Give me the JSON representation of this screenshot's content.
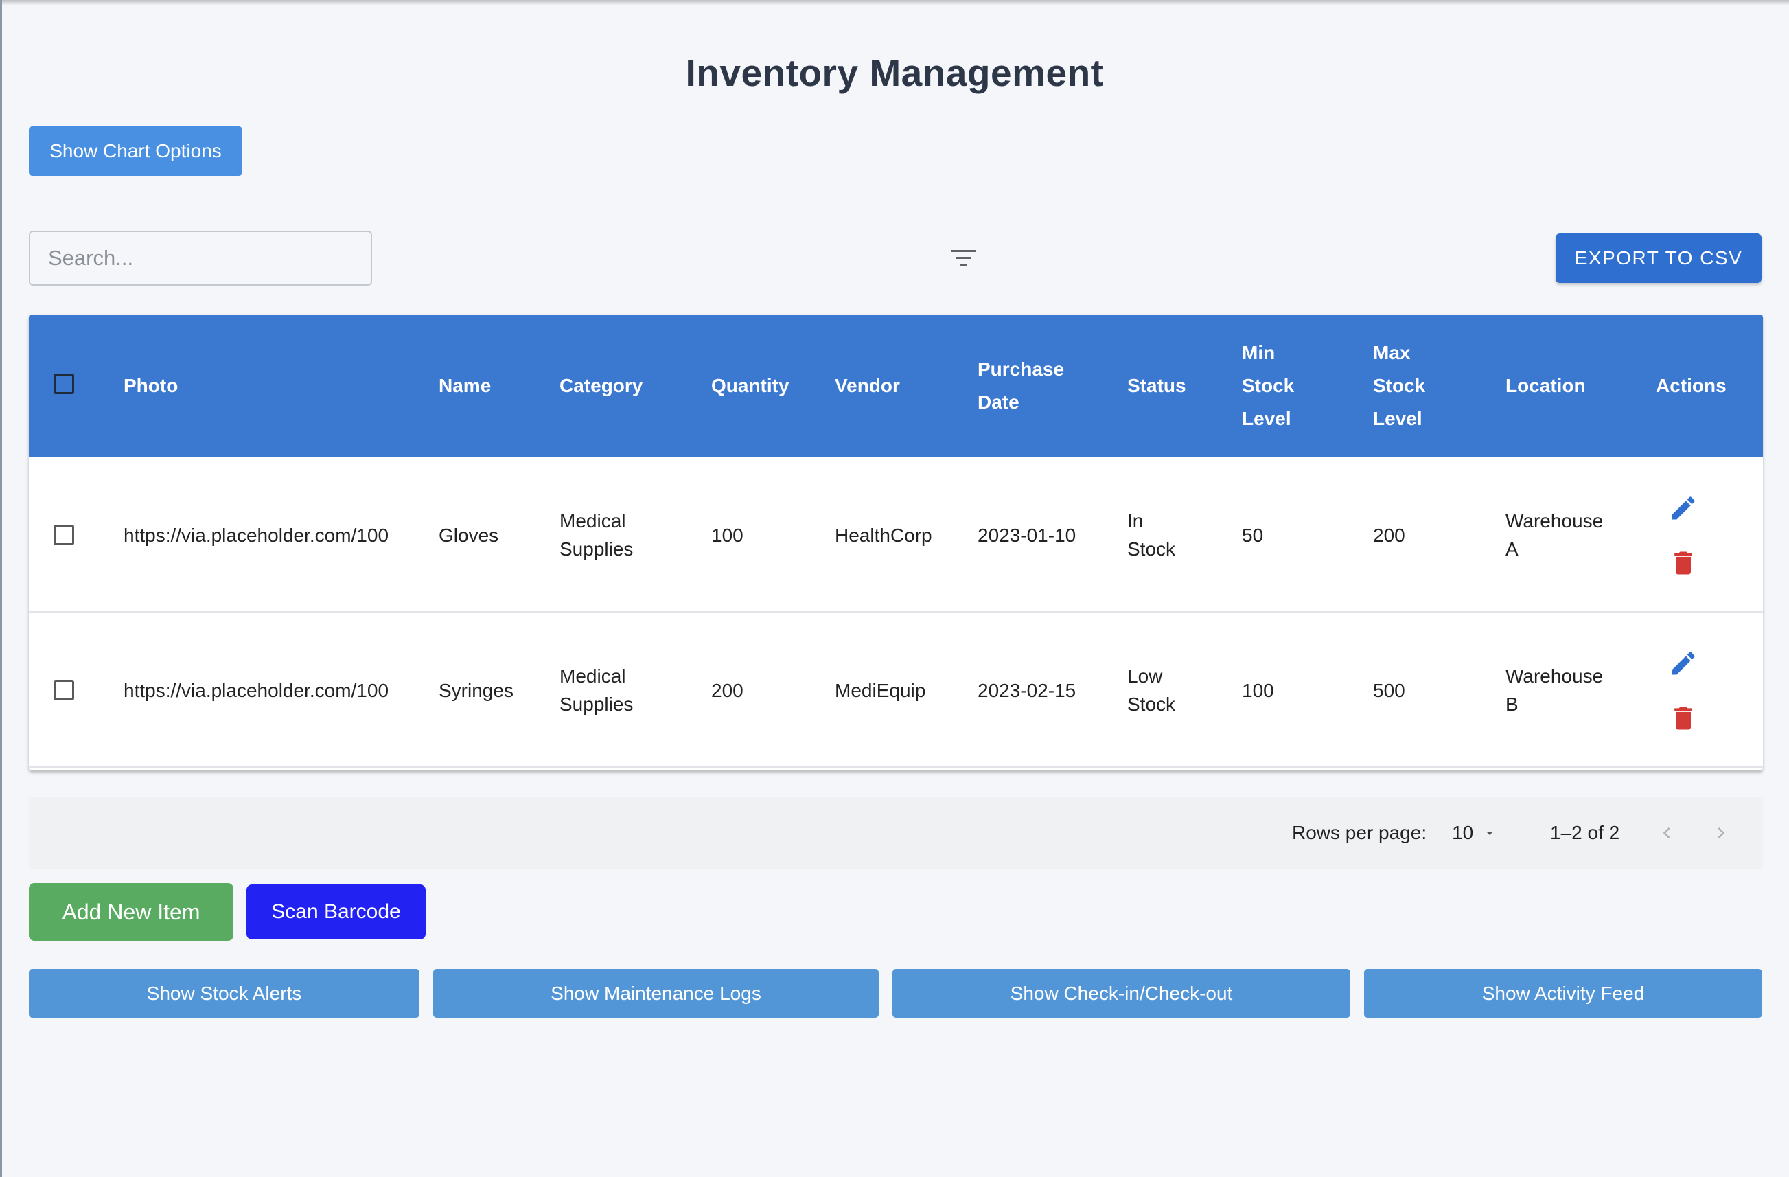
{
  "page": {
    "title": "Inventory Management"
  },
  "toolbar": {
    "chart_options_label": "Show Chart Options",
    "search_placeholder": "Search...",
    "filter_icon": "filter-list-icon",
    "export_label": "EXPORT TO CSV"
  },
  "table": {
    "columns": [
      "Photo",
      "Name",
      "Category",
      "Quantity",
      "Vendor",
      "Purchase Date",
      "Status",
      "Min Stock Level",
      "Max Stock Level",
      "Location",
      "Actions"
    ],
    "column_lines": {
      "purchase_date": [
        "Purchase",
        "Date"
      ],
      "min_stock": [
        "Min",
        "Stock",
        "Level"
      ],
      "max_stock": [
        "Max",
        "Stock",
        "Level"
      ]
    },
    "rows": [
      {
        "photo": "https://via.placeholder.com/100",
        "name": "Gloves",
        "category": [
          "Medical",
          "Supplies"
        ],
        "quantity": "100",
        "vendor": "HealthCorp",
        "purchase_date": "2023-01-10",
        "status": [
          "In",
          "Stock"
        ],
        "min_stock": "50",
        "max_stock": "200",
        "location": [
          "Warehouse",
          "A"
        ]
      },
      {
        "photo": "https://via.placeholder.com/100",
        "name": "Syringes",
        "category": [
          "Medical",
          "Supplies"
        ],
        "quantity": "200",
        "vendor": "MediEquip",
        "purchase_date": "2023-02-15",
        "status": [
          "Low",
          "Stock"
        ],
        "min_stock": "100",
        "max_stock": "500",
        "location": [
          "Warehouse",
          "B"
        ]
      }
    ]
  },
  "pagination": {
    "rows_per_page_label": "Rows per page:",
    "rows_per_page_value": "10",
    "range_text": "1–2 of 2"
  },
  "actions": {
    "add_label": "Add New Item",
    "scan_label": "Scan Barcode",
    "stock_alerts_label": "Show Stock Alerts",
    "maintenance_logs_label": "Show Maintenance Logs",
    "checkin_label": "Show Check-in/Check-out",
    "activity_feed_label": "Show Activity Feed"
  },
  "colors": {
    "header_blue": "#3b78d0",
    "edit_icon": "#2f6fd0",
    "delete_icon": "#d33a36",
    "add_green": "#58ab60",
    "scan_blue": "#2222f2"
  }
}
